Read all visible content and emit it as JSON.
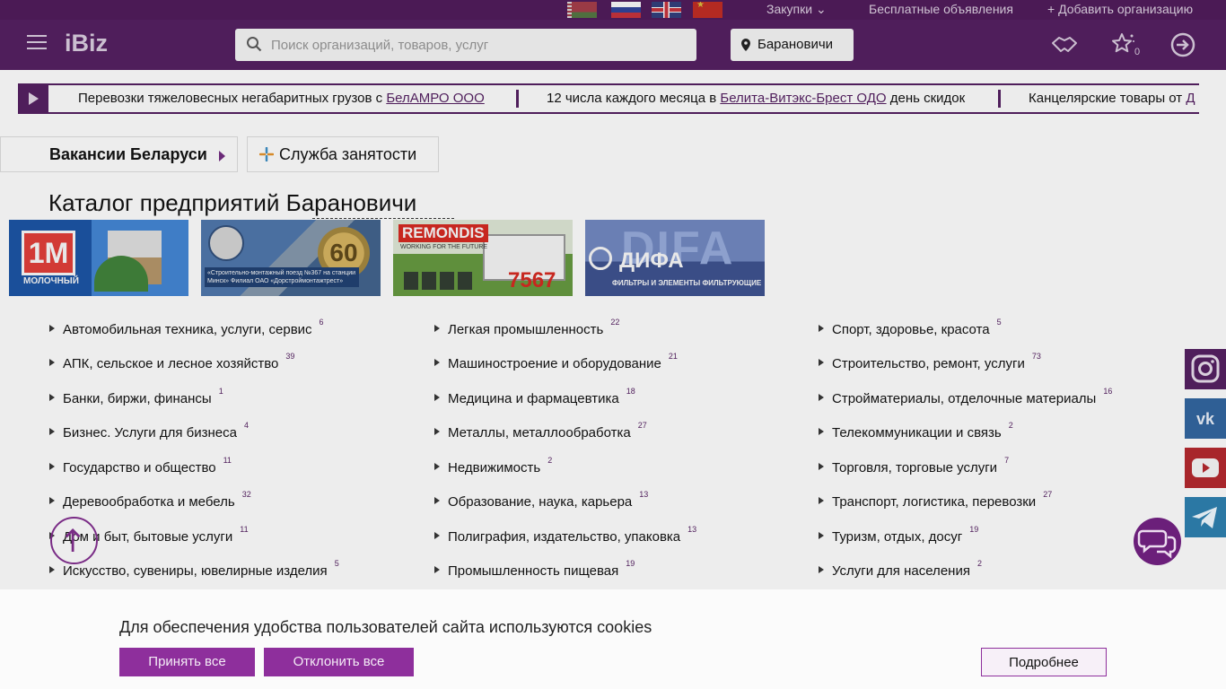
{
  "topbar": {
    "flags": [
      "by-flag",
      "ru-flag",
      "gb-flag",
      "cn-flag"
    ],
    "purchases": "Закупки",
    "free_ads": "Бесплатные объявления",
    "add_org": "Добавить организацию"
  },
  "header": {
    "logo": "iBiz",
    "search_placeholder": "Поиск организаций, товаров, услуг",
    "city": "Барановичи",
    "favorites_count": "0"
  },
  "ticker": [
    {
      "pre": "Перевозки тяжеловесных негабаритных грузов с ",
      "link": "БелАМРО ООО",
      "post": ""
    },
    {
      "pre": "12 числа каждого месяца в ",
      "link": "Белита-Витэкс-Брест ОДО",
      "post": " день скидок"
    },
    {
      "pre": "Канцелярские товары от ",
      "link": "Д",
      "post": ""
    }
  ],
  "tabs": {
    "vacancies": "Вакансии Беларуси",
    "employment": "Служба занятости"
  },
  "page_title": "Каталог предприятий Барановичи",
  "banners": {
    "b1_logo": "1M",
    "b1_caption": "МОЛОЧНЫЙ",
    "b2_badge": "60",
    "b2_label": "«Строительно-монтажный поезд №367 на станции Минск» Филиал ОАО «Дорстроймонтажтрест»",
    "b3_brand": "REMONDIS",
    "b3_slogan": "WORKING FOR THE FUTURE",
    "b3_number": "7567",
    "b4_bg": "DIFA",
    "b4_name": "ДИФА",
    "b4_sub": "ФИЛЬТРЫ И ЭЛЕМЕНТЫ ФИЛЬТРУЮЩИЕ"
  },
  "categories": {
    "col1": [
      {
        "label": "Автомобильная техника, услуги, сервис",
        "count": "6"
      },
      {
        "label": "АПК, сельское и лесное хозяйство",
        "count": "39"
      },
      {
        "label": "Банки, биржи, финансы",
        "count": "1"
      },
      {
        "label": "Бизнес. Услуги для бизнеса",
        "count": "4"
      },
      {
        "label": "Государство и общество",
        "count": "11"
      },
      {
        "label": "Деревообработка и мебель",
        "count": "32"
      },
      {
        "label": "Дом и быт, бытовые услуги",
        "count": "11"
      },
      {
        "label": "Искусство, сувениры, ювелирные изделия",
        "count": "5"
      }
    ],
    "col2": [
      {
        "label": "Легкая промышленность",
        "count": "22"
      },
      {
        "label": "Машиностроение и оборудование",
        "count": "21"
      },
      {
        "label": "Медицина и фармацевтика",
        "count": "18"
      },
      {
        "label": "Металлы, металлообработка",
        "count": "27"
      },
      {
        "label": "Недвижимость",
        "count": "2"
      },
      {
        "label": "Образование, наука, карьера",
        "count": "13"
      },
      {
        "label": "Полиграфия, издательство, упаковка",
        "count": "13"
      },
      {
        "label": "Промышленность пищевая",
        "count": "19"
      }
    ],
    "col3": [
      {
        "label": "Спорт, здоровье, красота",
        "count": "5"
      },
      {
        "label": "Строительство, ремонт, услуги",
        "count": "73"
      },
      {
        "label": "Стройматериалы, отделочные материалы",
        "count": "16"
      },
      {
        "label": "Телекоммуникации и связь",
        "count": "2"
      },
      {
        "label": "Торговля, торговые услуги",
        "count": "7"
      },
      {
        "label": "Транспорт, логистика, перевозки",
        "count": "27"
      },
      {
        "label": "Туризм, отдых, досуг",
        "count": "19"
      },
      {
        "label": "Услуги для населения",
        "count": "2"
      }
    ]
  },
  "social": [
    "instagram-icon",
    "vk-icon",
    "youtube-icon",
    "telegram-icon"
  ],
  "cookie": {
    "text": "Для обеспечения удобства пользователей сайта используются cookies",
    "accept": "Принять все",
    "reject": "Отклонить все",
    "more": "Подробнее"
  },
  "colors": {
    "brand": "#4f1e5b",
    "button": "#8e2f9c"
  }
}
